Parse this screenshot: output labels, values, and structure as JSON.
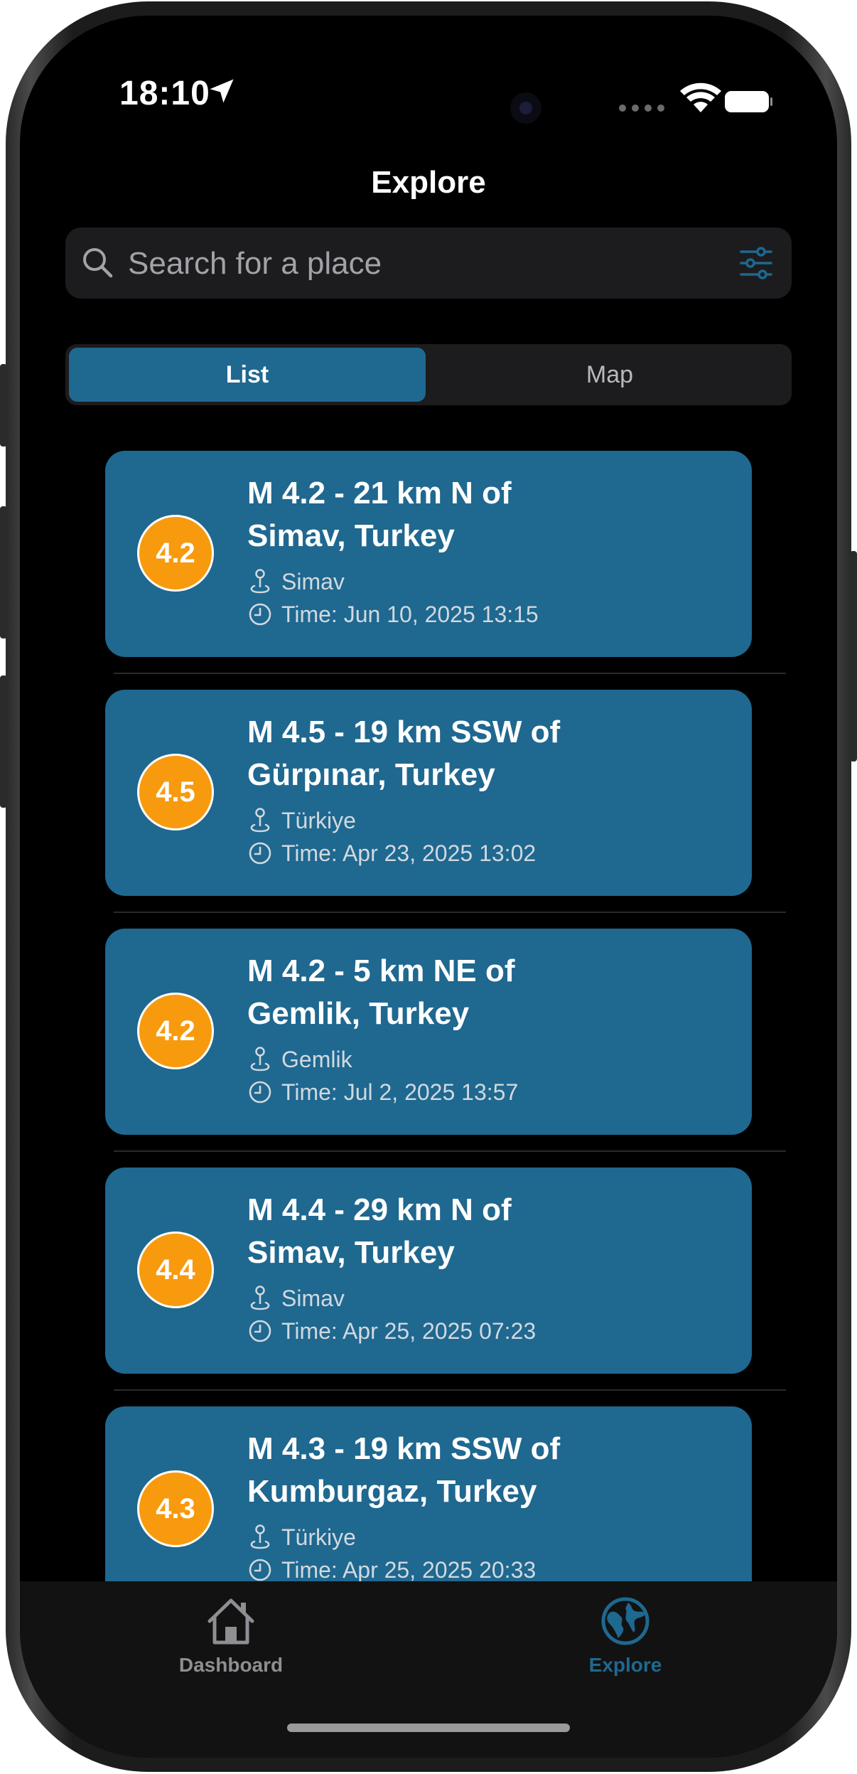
{
  "status_bar": {
    "time": "18:10"
  },
  "header": {
    "title": "Explore"
  },
  "search": {
    "placeholder": "Search for a place"
  },
  "segments": {
    "list_label": "List",
    "map_label": "Map"
  },
  "colors": {
    "accent": "#1f6890",
    "badge": "#f89a0e",
    "background": "#000000",
    "surface": "#1c1c1e"
  },
  "earthquakes": [
    {
      "magnitude": "4.2",
      "title_line1": "M 4.2 - 21 km N of",
      "title_line2": "Simav, Turkey",
      "place": "Simav",
      "time": "Time: Jun 10, 2025 13:15"
    },
    {
      "magnitude": "4.5",
      "title_line1": "M 4.5 - 19 km SSW of",
      "title_line2": "Gürpınar, Turkey",
      "place": "Türkiye",
      "time": "Time: Apr 23, 2025 13:02"
    },
    {
      "magnitude": "4.2",
      "title_line1": "M 4.2 - 5 km NE of",
      "title_line2": "Gemlik, Turkey",
      "place": "Gemlik",
      "time": "Time: Jul 2, 2025 13:57"
    },
    {
      "magnitude": "4.4",
      "title_line1": "M 4.4 - 29 km N of",
      "title_line2": "Simav, Turkey",
      "place": "Simav",
      "time": "Time: Apr 25, 2025 07:23"
    },
    {
      "magnitude": "4.3",
      "title_line1": "M 4.3 - 19 km SSW of",
      "title_line2": "Kumburgaz, Turkey",
      "place": "Türkiye",
      "time": "Time: Apr 25, 2025 20:33"
    }
  ],
  "tabbar": {
    "dashboard_label": "Dashboard",
    "explore_label": "Explore"
  }
}
